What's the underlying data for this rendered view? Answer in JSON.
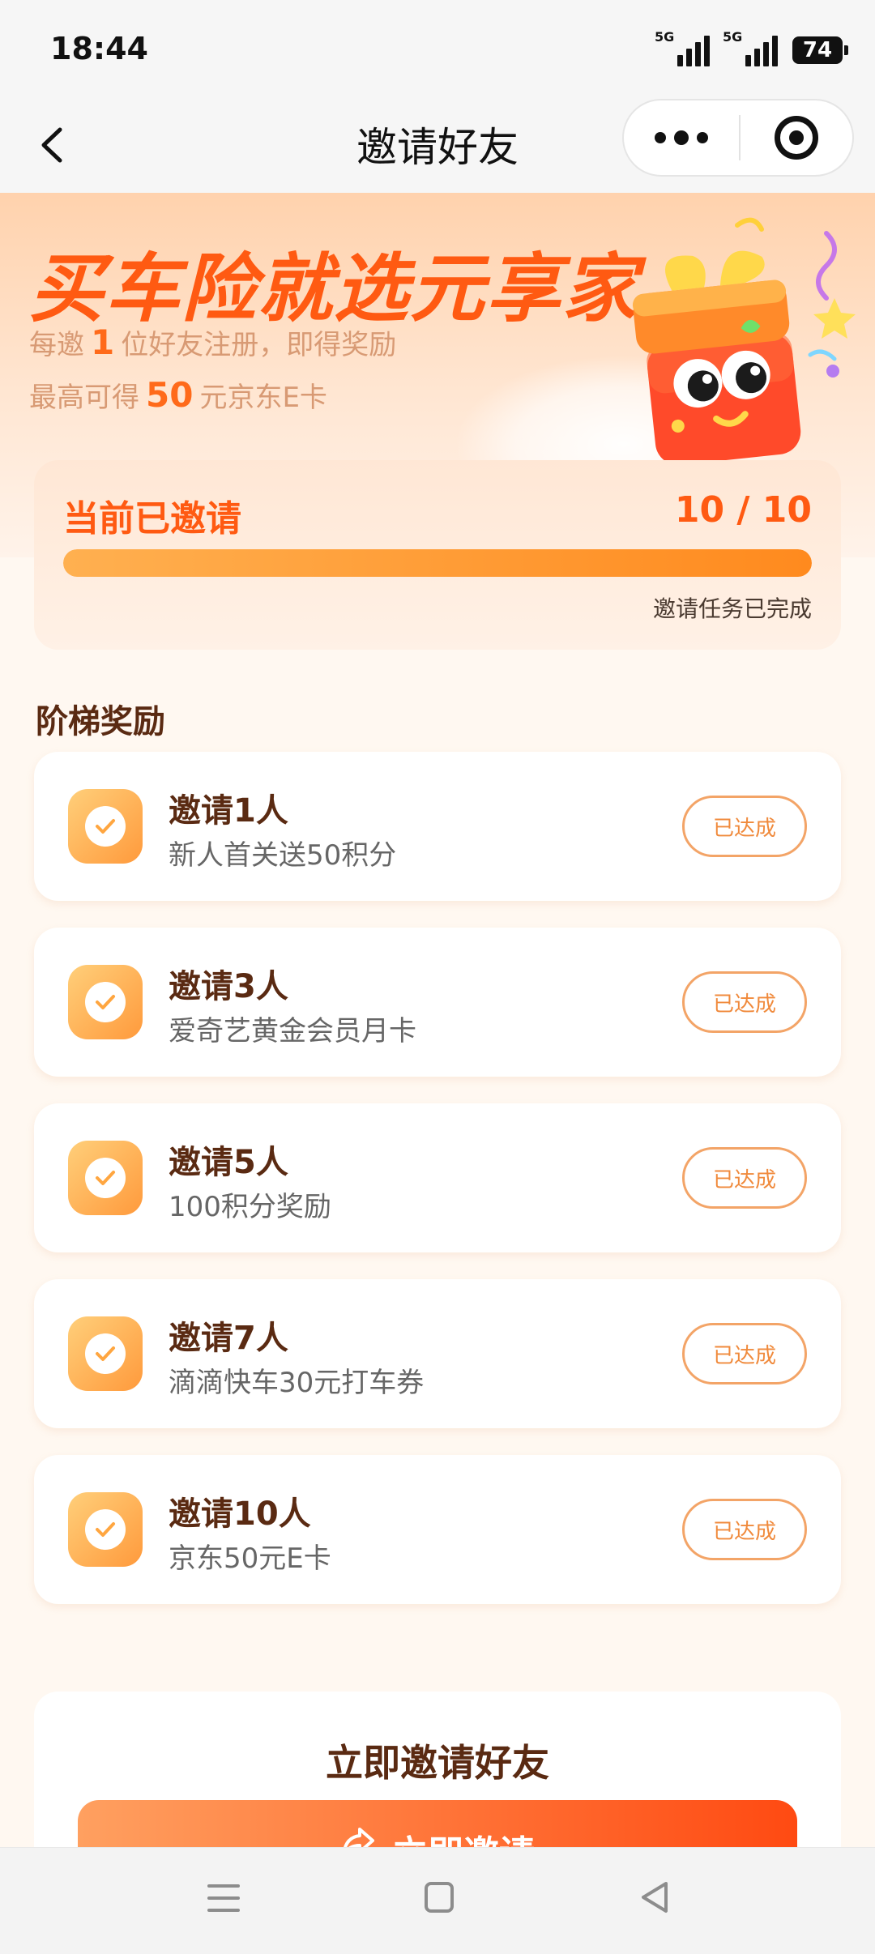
{
  "status_bar": {
    "time": "18:44",
    "signal1_tag": "5G",
    "signal2_tag": "5G",
    "battery": "74"
  },
  "nav": {
    "title": "邀请好友"
  },
  "hero": {
    "title": "买车险就选元享家",
    "line1_prefix": "每邀",
    "line1_num": "1",
    "line1_suffix": "位好友注册，即得奖励",
    "line2_prefix": "最高可得",
    "line2_num": "50",
    "line2_suffix": "元京东E卡"
  },
  "progress": {
    "label": "当前已邀请",
    "count_text": "10 / 10",
    "current": 10,
    "total": 10,
    "status": "邀请任务已完成"
  },
  "tiers": {
    "title": "阶梯奖励",
    "items": [
      {
        "title": "邀请1人",
        "desc": "新人首关送50积分",
        "badge": "已达成"
      },
      {
        "title": "邀请3人",
        "desc": "爱奇艺黄金会员月卡",
        "badge": "已达成"
      },
      {
        "title": "邀请5人",
        "desc": "100积分奖励",
        "badge": "已达成"
      },
      {
        "title": "邀请7人",
        "desc": "滴滴快车30元打车券",
        "badge": "已达成"
      },
      {
        "title": "邀请10人",
        "desc": "京东50元E卡",
        "badge": "已达成"
      }
    ]
  },
  "invite": {
    "title": "立即邀请好友",
    "button_label": "立即邀请"
  },
  "colors": {
    "accent": "#ff5a12",
    "badge_border": "#f3a467",
    "progress_fill": "#ff8a1e"
  },
  "icons": {
    "back": "chevron-left",
    "more": "three-dots",
    "close_target": "target-circle",
    "check": "checkmark",
    "share": "share-arrow"
  }
}
